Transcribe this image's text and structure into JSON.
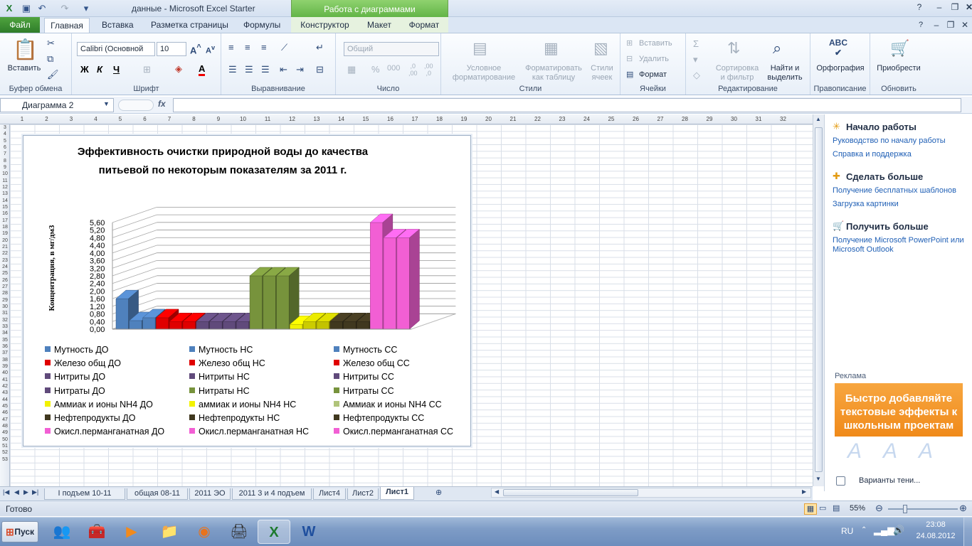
{
  "window": {
    "title": "данные  -  Microsoft Excel Starter",
    "context_header": "Работа с диаграммами"
  },
  "tabs": {
    "file": "Файл",
    "home": "Главная",
    "insert": "Вставка",
    "page_layout": "Разметка страницы",
    "formulas": "Формулы",
    "constructor": "Конструктор",
    "layout": "Макет",
    "format": "Формат"
  },
  "ribbon": {
    "paste": "Вставить",
    "clipboard": "Буфер обмена",
    "font_name": "Calibri (Основной",
    "font_size": "10",
    "font_group": "Шрифт",
    "bold": "Ж",
    "italic": "К",
    "underline": "Ч",
    "alignment": "Выравнивание",
    "number_format": "Общий",
    "number": "Число",
    "cond_format_1": "Условное",
    "cond_format_2": "форматирование",
    "format_table_1": "Форматировать",
    "format_table_2": "как таблицу",
    "cell_styles_1": "Стили",
    "cell_styles_2": "ячеек",
    "styles": "Стили",
    "insert_cells": "Вставить",
    "delete_cells": "Удалить",
    "format_cells": "Формат",
    "cells": "Ячейки",
    "sort_1": "Сортировка",
    "sort_2": "и фильтр",
    "find_1": "Найти и",
    "find_2": "выделить",
    "editing": "Редактирование",
    "spelling": "Орфография",
    "proofing": "Правописание",
    "purchase": "Приобрести",
    "update": "Обновить"
  },
  "formula_bar": {
    "name_box": "Диаграмма 2",
    "fx": "fx"
  },
  "columns": [
    "1",
    "2",
    "3",
    "4",
    "5",
    "6",
    "7",
    "8",
    "9",
    "10",
    "11",
    "12",
    "13",
    "14",
    "15",
    "16",
    "17",
    "18",
    "19",
    "20",
    "21",
    "22",
    "23",
    "24",
    "25",
    "26",
    "27",
    "28",
    "29",
    "30",
    "31",
    "32"
  ],
  "rows": [
    "3",
    "4",
    "5",
    "6",
    "7",
    "8",
    "9",
    "10",
    "11",
    "12",
    "13",
    "14",
    "15",
    "16",
    "17",
    "18",
    "19",
    "20",
    "21",
    "22",
    "23",
    "24",
    "25",
    "26",
    "27",
    "28",
    "29",
    "30",
    "31",
    "32",
    "33",
    "34",
    "35",
    "36",
    "37",
    "38",
    "39",
    "40",
    "41",
    "42",
    "43",
    "44",
    "45",
    "46",
    "47",
    "48",
    "49",
    "50",
    "51",
    "52",
    "53"
  ],
  "chart_data": {
    "type": "bar",
    "title_line1": "Эффективность  очистки природной воды до  качества",
    "title_line2": "питьевой по некоторым  показателям за 2011 г.",
    "ylabel": "Концентрация,  в мг/дм3",
    "ylim": [
      0,
      5.6
    ],
    "yticks": [
      "0,00",
      "0,40",
      "0,80",
      "1,20",
      "1,60",
      "2,00",
      "2,40",
      "2,80",
      "3,20",
      "3,60",
      "4,00",
      "4,40",
      "4,80",
      "5,20",
      "5,60"
    ],
    "series": [
      {
        "name": "Мутность ДО",
        "value": 1.6,
        "color": "#4f81bd"
      },
      {
        "name": "Мутность НС",
        "value": 0.45,
        "color": "#4f81bd"
      },
      {
        "name": "Мутность СС",
        "value": 0.6,
        "color": "#4f81bd"
      },
      {
        "name": "Железо общ ДО",
        "value": 0.6,
        "color": "#e00000"
      },
      {
        "name": "Железо общ НС",
        "value": 0.4,
        "color": "#e00000"
      },
      {
        "name": "Железо общ СС",
        "value": 0.4,
        "color": "#e00000"
      },
      {
        "name": "Нитриты ДО",
        "value": 0.4,
        "color": "#604a7b"
      },
      {
        "name": "Нитриты НС",
        "value": 0.4,
        "color": "#604a7b"
      },
      {
        "name": "Нитриты СС",
        "value": 0.4,
        "color": "#604a7b"
      },
      {
        "name": "Нитраты ДО",
        "value": 0.4,
        "color": "#604a7b"
      },
      {
        "name": "Нитраты НС",
        "value": 2.8,
        "color": "#77933c"
      },
      {
        "name": "Нитраты СС",
        "value": 2.8,
        "color": "#77933c"
      },
      {
        "name": "Аммиак и ионы NH4 ДО",
        "value": 2.8,
        "color": "#77933c"
      },
      {
        "name": "аммиак и ионы NH4 НС",
        "value": 0.25,
        "color": "#f2f200"
      },
      {
        "name": "Аммиак и ионы NH4 СС",
        "value": 0.4,
        "color": "#cccc00"
      },
      {
        "name": "Нефтепродукты ДО",
        "value": 0.4,
        "color": "#c3c300"
      },
      {
        "name": "Нефтепродукты НС",
        "value": 0.4,
        "color": "#40381f"
      },
      {
        "name": "Нефтепродукты СС",
        "value": 0.4,
        "color": "#40381f"
      },
      {
        "name": "Окисл.перманганатная ДО",
        "value": 0.4,
        "color": "#40381f"
      },
      {
        "name": "Окисл.перманганатная НС",
        "value": 5.6,
        "color": "#f25fd4"
      },
      {
        "name": "Окисл.перманганатная СС",
        "value": 4.8,
        "color": "#f25fd4"
      },
      {
        "name": "",
        "value": 4.8,
        "color": "#f25fd4"
      }
    ],
    "legend": [
      {
        "name": "Мутность ДО",
        "color": "#4f81bd"
      },
      {
        "name": "Мутность НС",
        "color": "#4f81bd"
      },
      {
        "name": "Мутность СС",
        "color": "#4f81bd"
      },
      {
        "name": "Железо общ ДО",
        "color": "#e00000"
      },
      {
        "name": "Железо общ НС",
        "color": "#e00000"
      },
      {
        "name": "Железо общ СС",
        "color": "#e00000"
      },
      {
        "name": "Нитриты ДО",
        "color": "#604a7b"
      },
      {
        "name": "Нитриты НС",
        "color": "#604a7b"
      },
      {
        "name": "Нитриты СС",
        "color": "#604a7b"
      },
      {
        "name": "Нитраты ДО",
        "color": "#604a7b"
      },
      {
        "name": "Нитраты НС",
        "color": "#77933c"
      },
      {
        "name": "Нитраты СС",
        "color": "#77933c"
      },
      {
        "name": "Аммиак и ионы NH4 ДО",
        "color": "#f2f200"
      },
      {
        "name": "аммиак и ионы NH4 НС",
        "color": "#f2f200"
      },
      {
        "name": "Аммиак и ионы NH4 СС",
        "color": "#b0c47a"
      },
      {
        "name": "Нефтепродукты ДО",
        "color": "#40381f"
      },
      {
        "name": "Нефтепродукты НС",
        "color": "#40381f"
      },
      {
        "name": "Нефтепродукты СС",
        "color": "#40381f"
      },
      {
        "name": "Окисл.перманганатная ДО",
        "color": "#f25fd4"
      },
      {
        "name": "Окисл.перманганатная НС",
        "color": "#f25fd4"
      },
      {
        "name": "Окисл.перманганатная СС",
        "color": "#f25fd4"
      }
    ],
    "legend_position": "bottom",
    "grid": true
  },
  "pane": {
    "h1": "Начало работы",
    "l1": "Руководство по началу работы",
    "l2": "Справка и поддержка",
    "h2": "Сделать больше",
    "l3": "Получение бесплатных шаблонов",
    "l4": "Загрузка картинки",
    "h3": "Получить больше",
    "l5a": "Получение Microsoft PowerPoint или",
    "l5b": "Microsoft Outlook",
    "ad_title": "Реклама",
    "ad_text": "Быстро добавляйте текстовые эффекты к школьным проектам",
    "ad_option": "Варианты тени..."
  },
  "sheets": [
    "I подъем 10-11",
    "общая 08-11",
    "2011 ЭО",
    "2011 3 и 4 подъем",
    "Лист4",
    "Лист2",
    "Лист1"
  ],
  "active_sheet": "Лист1",
  "status": {
    "ready": "Готово",
    "zoom": "55%"
  },
  "taskbar": {
    "start": "Пуск",
    "lang": "RU",
    "time": "23:08",
    "date": "24.08.2012"
  }
}
